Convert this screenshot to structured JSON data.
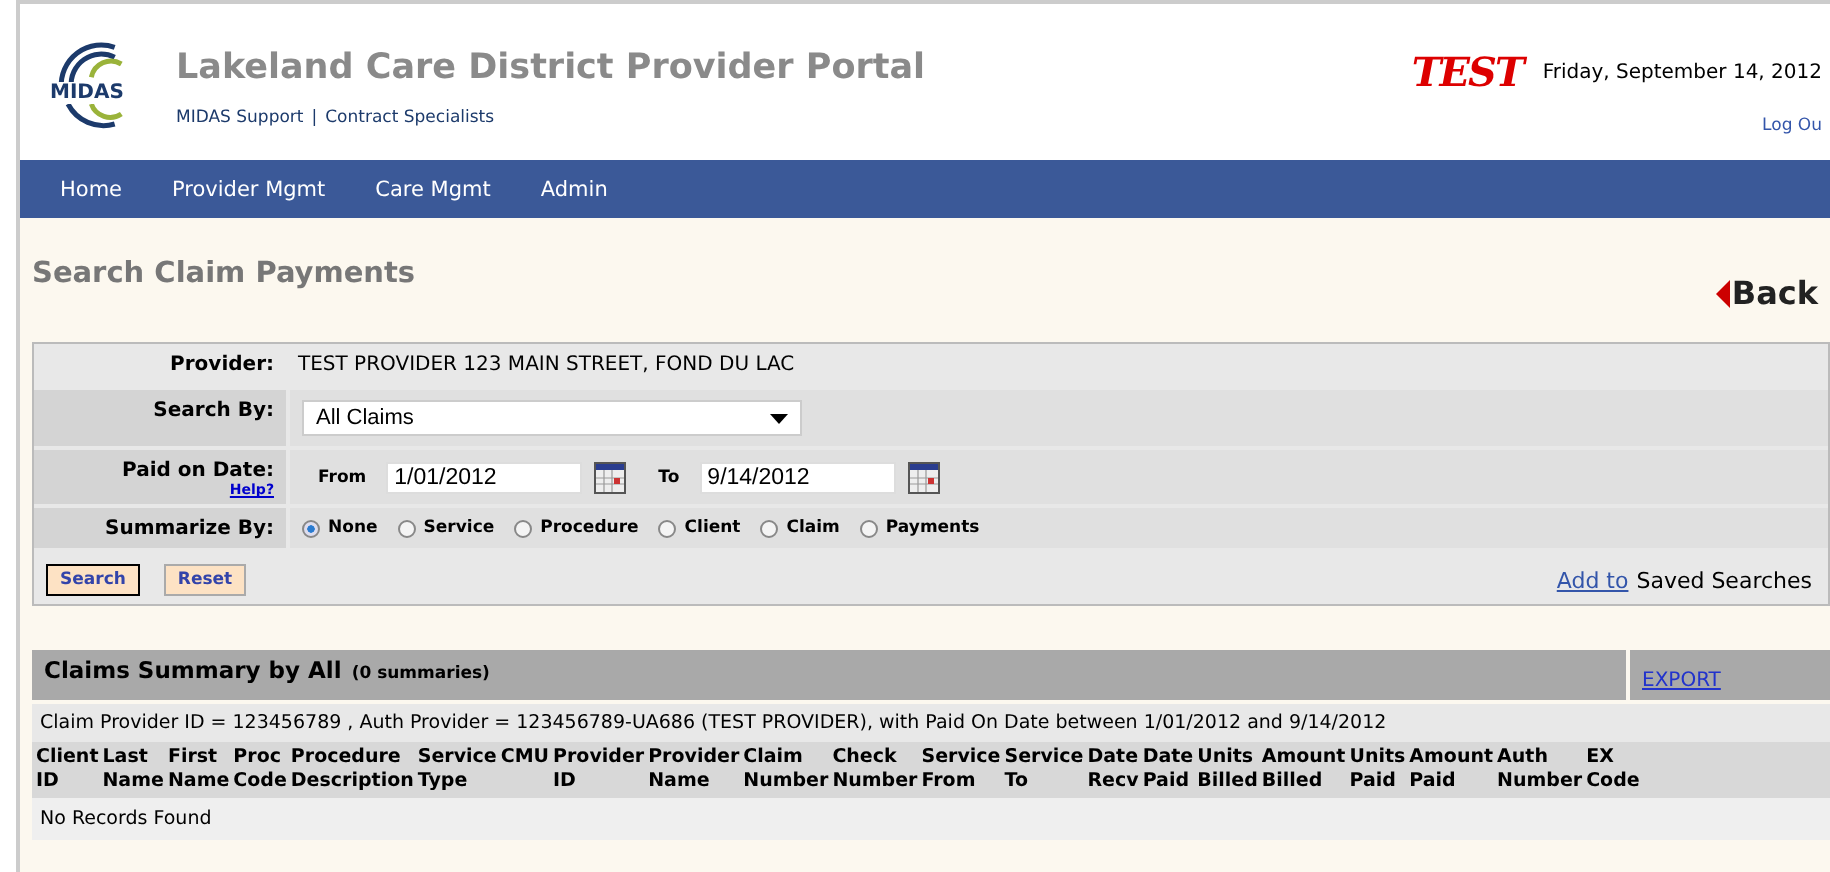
{
  "header": {
    "logo_text": "MIDAS",
    "title": "Lakeland Care District Provider Portal",
    "links": [
      "MIDAS Support",
      "Contract Specialists"
    ],
    "separator": "|",
    "badge": "TEST",
    "date": "Friday, September 14, 2012",
    "logout": "Log Ou"
  },
  "nav": [
    "Home",
    "Provider Mgmt",
    "Care Mgmt",
    "Admin"
  ],
  "page_title": "Search Claim Payments",
  "back": "Back",
  "form": {
    "provider_label": "Provider:",
    "provider_value": "TEST PROVIDER   123 MAIN STREET, FOND DU LAC",
    "search_by_label": "Search By:",
    "search_by_value": "All Claims",
    "paid_label": "Paid on Date:",
    "help": "Help?",
    "from_label": "From",
    "from_value": "1/01/2012",
    "to_label": "To",
    "to_value": "9/14/2012",
    "summarize_label": "Summarize By:",
    "options": [
      {
        "label": "None",
        "selected": true
      },
      {
        "label": "Service",
        "selected": false
      },
      {
        "label": "Procedure",
        "selected": false
      },
      {
        "label": "Client",
        "selected": false
      },
      {
        "label": "Claim",
        "selected": false
      },
      {
        "label": "Payments",
        "selected": false
      }
    ],
    "buttons": [
      "Search",
      "Reset"
    ],
    "add_link": "Add to",
    "saved": "Saved Searches"
  },
  "summary": {
    "title": "Claims Summary by All",
    "count": "(0 summaries)",
    "export": "EXPORT",
    "criteria": "Claim Provider ID = 123456789 , Auth Provider = 123456789-UA686 (TEST PROVIDER), with Paid On Date between 1/01/2012 and 9/14/2012",
    "columns": [
      {
        "label": "Client\nID"
      },
      {
        "label": "Last\nName"
      },
      {
        "label": "First\nName"
      },
      {
        "label": "Proc\nCode"
      },
      {
        "label": "Procedure\nDescription"
      },
      {
        "label": "Service\nType"
      },
      {
        "label": "CMU"
      },
      {
        "label": "Provider\nID"
      },
      {
        "label": "Provider\nName"
      },
      {
        "label": "Claim\nNumber"
      },
      {
        "label": "Check\nNumber"
      },
      {
        "label": "Service\nFrom"
      },
      {
        "label": "Service\nTo"
      },
      {
        "label": "Date\nRecv"
      },
      {
        "label": "Date\nPaid"
      },
      {
        "label": "Units\nBilled"
      },
      {
        "label": "Amount\nBilled"
      },
      {
        "label": "Units\nPaid"
      },
      {
        "label": "Amount\nPaid"
      },
      {
        "label": "Auth\nNumber"
      },
      {
        "label": "EX\nCode"
      }
    ],
    "empty": "No Records Found"
  }
}
